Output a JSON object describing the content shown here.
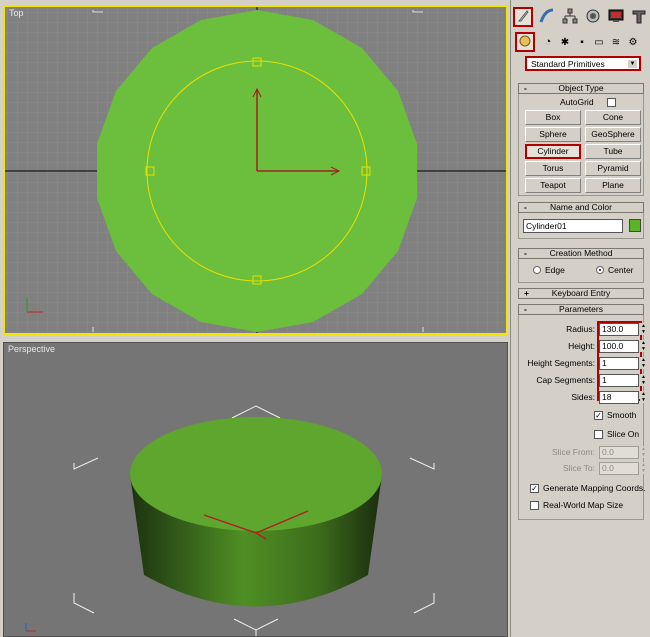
{
  "viewports": {
    "top_label": "Top",
    "perspective_label": "Perspective"
  },
  "command_panel": {
    "tabs": [
      "create-icon",
      "modify-icon",
      "hierarchy-icon",
      "motion-icon",
      "display-icon",
      "utilities-icon"
    ],
    "categories": [
      "geometry-icon",
      "shapes-icon",
      "lights-icon",
      "cameras-icon",
      "helpers-icon",
      "spacewarps-icon",
      "systems-icon"
    ],
    "dropdown_value": "Standard Primitives",
    "object_type": {
      "title": "Object Type",
      "autogrid_label": "AutoGrid",
      "buttons": [
        "Box",
        "Cone",
        "Sphere",
        "GeoSphere",
        "Cylinder",
        "Tube",
        "Torus",
        "Pyramid",
        "Teapot",
        "Plane"
      ],
      "selected": "Cylinder"
    },
    "name_and_color": {
      "title": "Name and Color",
      "name_value": "Cylinder01",
      "color": "#5ab428"
    },
    "creation_method": {
      "title": "Creation Method",
      "edge_label": "Edge",
      "center_label": "Center",
      "selected": "Center"
    },
    "keyboard_entry": {
      "title": "Keyboard Entry"
    },
    "parameters": {
      "title": "Parameters",
      "radius_label": "Radius:",
      "radius_value": "130.0",
      "height_label": "Height:",
      "height_value": "100.0",
      "height_segments_label": "Height Segments:",
      "height_segments_value": "1",
      "cap_segments_label": "Cap Segments:",
      "cap_segments_value": "1",
      "sides_label": "Sides:",
      "sides_value": "18",
      "smooth_label": "Smooth",
      "smooth_checked": true,
      "slice_on_label": "Slice On",
      "slice_on_checked": false,
      "slice_from_label": "Slice From:",
      "slice_from_value": "0.0",
      "slice_to_label": "Slice To:",
      "slice_to_value": "0.0",
      "gen_mapping_label": "Generate Mapping Coords.",
      "gen_mapping_checked": true,
      "realworld_label": "Real-World Map Size",
      "realworld_checked": false
    }
  },
  "colors": {
    "object_green": "#6cbf3c",
    "active_viewport_border": "#f2e600",
    "highlight_red": "#b00000"
  }
}
